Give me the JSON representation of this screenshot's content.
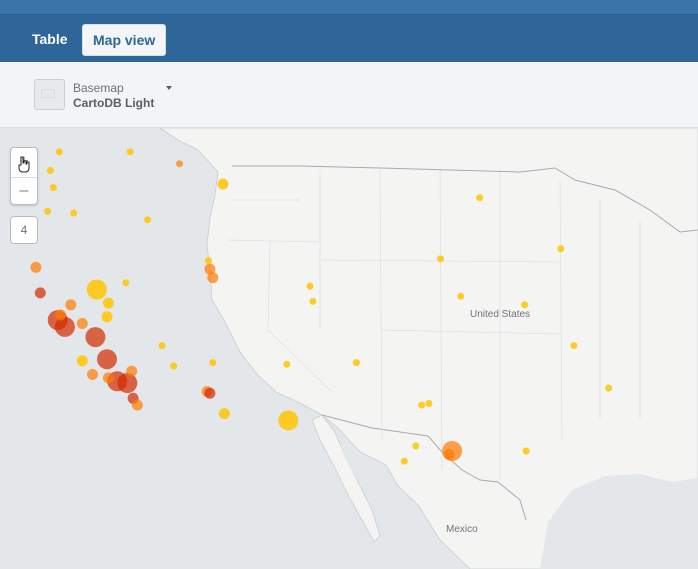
{
  "tabs": {
    "table_label": "Table",
    "map_label": "Map view"
  },
  "basemap": {
    "label": "Basemap",
    "value": "CartoDB Light"
  },
  "zoom": {
    "in_icon": "plus-icon",
    "out_icon": "minus-icon",
    "level": "4"
  },
  "map_labels": {
    "country_us": "United States",
    "country_mx": "Mexico"
  },
  "colors": {
    "header": "#2f6699",
    "point_yellow": "#ffc400",
    "point_orange": "#ff7a00",
    "point_red": "#d32a00"
  },
  "points": [
    {
      "lon": -122.4,
      "lat": 37.7,
      "size": "l",
      "tone": "red"
    },
    {
      "lon": -121.9,
      "lat": 37.3,
      "size": "l",
      "tone": "red"
    },
    {
      "lon": -122.2,
      "lat": 38.0,
      "size": "m",
      "tone": "orange"
    },
    {
      "lon": -123.6,
      "lat": 39.3,
      "size": "m",
      "tone": "red"
    },
    {
      "lon": -123.9,
      "lat": 40.8,
      "size": "m",
      "tone": "orange"
    },
    {
      "lon": -121.5,
      "lat": 38.6,
      "size": "m",
      "tone": "orange"
    },
    {
      "lon": -120.7,
      "lat": 37.5,
      "size": "m",
      "tone": "orange"
    },
    {
      "lon": -119.8,
      "lat": 36.7,
      "size": "l",
      "tone": "red"
    },
    {
      "lon": -119.0,
      "lat": 35.4,
      "size": "l",
      "tone": "red"
    },
    {
      "lon": -118.3,
      "lat": 34.1,
      "size": "l",
      "tone": "red"
    },
    {
      "lon": -117.6,
      "lat": 34.0,
      "size": "l",
      "tone": "red"
    },
    {
      "lon": -117.2,
      "lat": 33.1,
      "size": "m",
      "tone": "red"
    },
    {
      "lon": -116.9,
      "lat": 32.7,
      "size": "m",
      "tone": "orange"
    },
    {
      "lon": -117.3,
      "lat": 34.7,
      "size": "m",
      "tone": "orange"
    },
    {
      "lon": -118.9,
      "lat": 34.3,
      "size": "m",
      "tone": "orange"
    },
    {
      "lon": -120.0,
      "lat": 34.5,
      "size": "m",
      "tone": "orange"
    },
    {
      "lon": -120.7,
      "lat": 35.3,
      "size": "m",
      "tone": "yellow"
    },
    {
      "lon": -119.7,
      "lat": 39.5,
      "size": "l",
      "tone": "yellow"
    },
    {
      "lon": -118.9,
      "lat": 38.7,
      "size": "m",
      "tone": "yellow"
    },
    {
      "lon": -119.0,
      "lat": 37.9,
      "size": "m",
      "tone": "yellow"
    },
    {
      "lon": -117.7,
      "lat": 39.9,
      "size": "s",
      "tone": "yellow"
    },
    {
      "lon": -115.2,
      "lat": 36.2,
      "size": "s",
      "tone": "yellow"
    },
    {
      "lon": -114.4,
      "lat": 35.0,
      "size": "s",
      "tone": "yellow"
    },
    {
      "lon": -122.7,
      "lat": 45.5,
      "size": "s",
      "tone": "yellow"
    },
    {
      "lon": -122.3,
      "lat": 47.6,
      "size": "s",
      "tone": "yellow"
    },
    {
      "lon": -122.9,
      "lat": 46.5,
      "size": "s",
      "tone": "yellow"
    },
    {
      "lon": -123.1,
      "lat": 44.1,
      "size": "s",
      "tone": "yellow"
    },
    {
      "lon": -121.3,
      "lat": 44.0,
      "size": "s",
      "tone": "yellow"
    },
    {
      "lon": -117.4,
      "lat": 47.6,
      "size": "s",
      "tone": "yellow"
    },
    {
      "lon": -116.2,
      "lat": 43.6,
      "size": "s",
      "tone": "yellow"
    },
    {
      "lon": -114.0,
      "lat": 46.9,
      "size": "s",
      "tone": "orange"
    },
    {
      "lon": -111.0,
      "lat": 45.7,
      "size": "m",
      "tone": "yellow"
    },
    {
      "lon": -111.9,
      "lat": 40.7,
      "size": "m",
      "tone": "orange"
    },
    {
      "lon": -111.7,
      "lat": 40.2,
      "size": "m",
      "tone": "orange"
    },
    {
      "lon": -112.0,
      "lat": 41.2,
      "size": "s",
      "tone": "yellow"
    },
    {
      "lon": -111.7,
      "lat": 35.2,
      "size": "s",
      "tone": "yellow"
    },
    {
      "lon": -112.1,
      "lat": 33.5,
      "size": "m",
      "tone": "orange"
    },
    {
      "lon": -111.9,
      "lat": 33.4,
      "size": "m",
      "tone": "red"
    },
    {
      "lon": -110.9,
      "lat": 32.2,
      "size": "m",
      "tone": "yellow"
    },
    {
      "lon": -105.0,
      "lat": 39.7,
      "size": "s",
      "tone": "yellow"
    },
    {
      "lon": -104.8,
      "lat": 38.8,
      "size": "s",
      "tone": "yellow"
    },
    {
      "lon": -106.6,
      "lat": 35.1,
      "size": "s",
      "tone": "yellow"
    },
    {
      "lon": -106.5,
      "lat": 31.8,
      "size": "l",
      "tone": "yellow"
    },
    {
      "lon": -101.8,
      "lat": 35.2,
      "size": "s",
      "tone": "yellow"
    },
    {
      "lon": -97.3,
      "lat": 32.7,
      "size": "s",
      "tone": "yellow"
    },
    {
      "lon": -96.8,
      "lat": 32.8,
      "size": "s",
      "tone": "yellow"
    },
    {
      "lon": -95.4,
      "lat": 29.8,
      "size": "m",
      "tone": "orange"
    },
    {
      "lon": -95.2,
      "lat": 30.0,
      "size": "l",
      "tone": "orange"
    },
    {
      "lon": -97.7,
      "lat": 30.3,
      "size": "s",
      "tone": "yellow"
    },
    {
      "lon": -98.5,
      "lat": 29.4,
      "size": "s",
      "tone": "yellow"
    },
    {
      "lon": -94.6,
      "lat": 39.1,
      "size": "s",
      "tone": "yellow"
    },
    {
      "lon": -96.0,
      "lat": 41.3,
      "size": "s",
      "tone": "yellow"
    },
    {
      "lon": -93.3,
      "lat": 44.9,
      "size": "s",
      "tone": "yellow"
    },
    {
      "lon": -90.2,
      "lat": 38.6,
      "size": "s",
      "tone": "yellow"
    },
    {
      "lon": -90.1,
      "lat": 30.0,
      "size": "s",
      "tone": "yellow"
    },
    {
      "lon": -84.4,
      "lat": 33.7,
      "size": "s",
      "tone": "yellow"
    },
    {
      "lon": -86.8,
      "lat": 36.2,
      "size": "s",
      "tone": "yellow"
    },
    {
      "lon": -87.7,
      "lat": 41.9,
      "size": "s",
      "tone": "yellow"
    }
  ]
}
